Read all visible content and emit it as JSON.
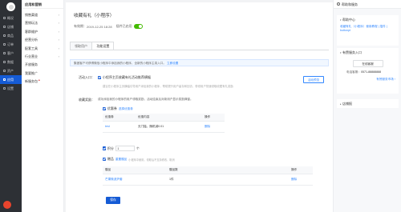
{
  "sidebar": {
    "items": [
      {
        "label": "概况"
      },
      {
        "label": "店铺"
      },
      {
        "label": "商品"
      },
      {
        "label": "订单"
      },
      {
        "label": "客户"
      },
      {
        "label": "数据"
      },
      {
        "label": "资产"
      },
      {
        "label": "应用"
      },
      {
        "label": "设置"
      }
    ],
    "active_index": 7
  },
  "subnav": {
    "title": "应用和营销",
    "items": [
      {
        "label": "销售渠道",
        "arrow": "›"
      },
      {
        "label": "营销玩法",
        "arrow": "›"
      },
      {
        "label": "客群维护",
        "arrow": "›"
      },
      {
        "label": "经营分析",
        "arrow": "›"
      },
      {
        "label": "配套工具",
        "arrow": "›"
      },
      {
        "label": "行业营业",
        "arrow": "›"
      },
      {
        "label": "开放服务",
        "arrow": ""
      },
      {
        "label": "我要推广",
        "arrow": ""
      },
      {
        "label": "新服务包",
        "arrow": "",
        "badge": "•"
      }
    ]
  },
  "main": {
    "title": "收藏有礼（小程序）",
    "meta": {
      "period_label": "有效期：",
      "period_value": "2019-12-25 18:28",
      "status_label": "插件已启用"
    },
    "tabs": [
      {
        "label": "领取用户"
      },
      {
        "label": "功能设置"
      }
    ],
    "active_tab": 1,
    "notice": {
      "text": "集团客户可获得微信小程序中添加我的小程序，全新的小程序主真入口。",
      "link": "立即设置"
    },
    "entry": {
      "label": "活动入口：",
      "option": "小程序主页收藏有礼活动推荐横幅",
      "hint": "建议在小程序主页横幅引导用户添加我的小程序，帮助提升用户留存和回访，带领用户快速领取收藏有礼奖励",
      "preview_button": "活动预览"
    },
    "reward": {
      "label": "收藏奖励：",
      "description": "成功添加我的小程序的用户领取奖励，活动结束后对新用户显示奖励弹窗。",
      "coupon": {
        "checkbox": "优惠券",
        "link": "选择优惠券",
        "columns": [
          "优惠券",
          "优惠内容",
          "操作"
        ],
        "rows": [
          {
            "name": "test",
            "content": "无门槛，随机减0.01",
            "action": "删除"
          }
        ]
      },
      "points": {
        "checkbox": "积分",
        "value": "1",
        "unit": "个"
      },
      "gift": {
        "checkbox": "赠品",
        "link": "重置赠品",
        "note": "小程序中使用，领取后不支持修改、取消",
        "columns": [
          "赠品",
          "赠品数",
          "操作"
        ],
        "rows": [
          {
            "name": "芒果微波炉套",
            "count": "1件",
            "action": "删除"
          }
        ]
      }
    },
    "save_button": "保存"
  },
  "rightpanel": {
    "title": "帮助和服务",
    "help_center": {
      "title": "帮助中心",
      "link": "收藏有礼（小程序）使用教程 | 插件 | buttonpt"
    },
    "service": {
      "title": "有赞服务入口",
      "online_button": "在线客服",
      "phone_label": "电话客服：",
      "phone": "0571-88888888",
      "link": "有赞服务市场 ›"
    },
    "report": {
      "title": "店铺报"
    }
  },
  "colors": {
    "primary": "#155bd5",
    "link": "#3388ff",
    "sidebar_bg": "#2d3035",
    "toggle_on": "#44bb00"
  }
}
